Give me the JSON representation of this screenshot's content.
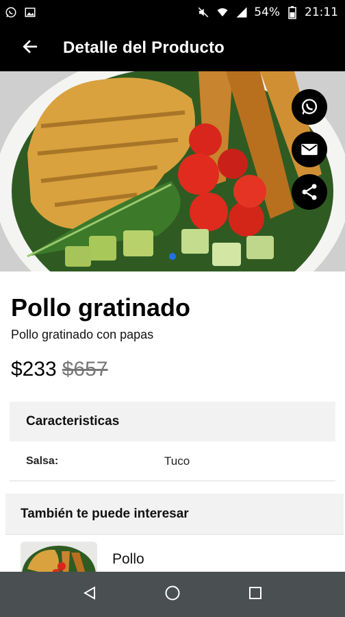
{
  "status_bar": {
    "battery": "54%",
    "time": "21:11",
    "left_icons": [
      "whatsapp-icon",
      "image-icon"
    ],
    "right_icons": [
      "mute-icon",
      "wifi-icon",
      "signal-icon",
      "battery-icon"
    ]
  },
  "app_bar": {
    "title": "Detalle del Producto",
    "back_icon": "arrow-left-icon"
  },
  "hero": {
    "share_actions": [
      "whatsapp-icon",
      "mail-icon",
      "share-icon"
    ],
    "accent_color": "#1e73e8"
  },
  "product": {
    "name": "Pollo gratinado",
    "description": "Pollo gratinado con papas",
    "price": "$233",
    "old_price": "$657"
  },
  "features": {
    "title": "Caracteristicas",
    "rows": [
      {
        "key": "Salsa:",
        "value": "Tuco"
      }
    ]
  },
  "related": {
    "title": "También te puede interesar",
    "items": [
      {
        "name": "Pollo"
      }
    ]
  },
  "nav_bar": {
    "buttons": [
      "back-triangle-icon",
      "home-circle-icon",
      "recents-square-icon"
    ]
  }
}
